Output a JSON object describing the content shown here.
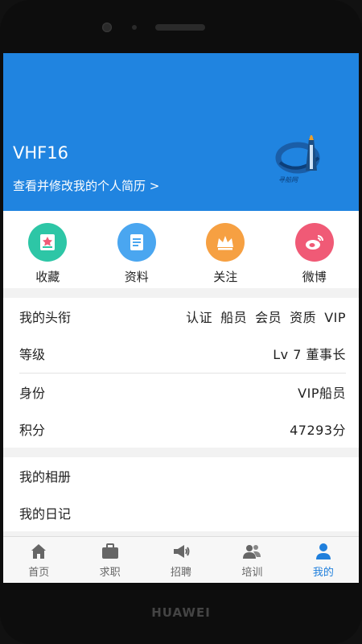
{
  "device": {
    "brand": "HUAWEI"
  },
  "profile": {
    "username": "VHF16",
    "resume_link": "查看并修改我的个人简历 >",
    "logo_text": "寻船网"
  },
  "quick_actions": [
    {
      "label": "收藏",
      "icon": "bookmark-icon",
      "color": "#2dc6a6"
    },
    {
      "label": "资料",
      "icon": "document-icon",
      "color": "#4aa6f0"
    },
    {
      "label": "关注",
      "icon": "crown-icon",
      "color": "#f6a042"
    },
    {
      "label": "微博",
      "icon": "weibo-icon",
      "color": "#f05a76"
    }
  ],
  "info": {
    "title_label": "我的头衔",
    "title_tags": [
      "认证",
      "船员",
      "会员",
      "资质",
      "VIP"
    ],
    "level_label": "等级",
    "level_value": "Lv 7 董事长",
    "identity_label": "身份",
    "identity_value": "VIP船员",
    "points_label": "积分",
    "points_value": "47293分"
  },
  "menu": {
    "album": "我的相册",
    "diary": "我的日记"
  },
  "tabs": [
    {
      "label": "首页",
      "icon": "home-icon"
    },
    {
      "label": "求职",
      "icon": "briefcase-icon"
    },
    {
      "label": "招聘",
      "icon": "megaphone-icon"
    },
    {
      "label": "培训",
      "icon": "people-icon"
    },
    {
      "label": "我的",
      "icon": "person-icon",
      "active": true
    }
  ],
  "colors": {
    "header": "#2084e0",
    "active_tab": "#1f7fdc"
  }
}
